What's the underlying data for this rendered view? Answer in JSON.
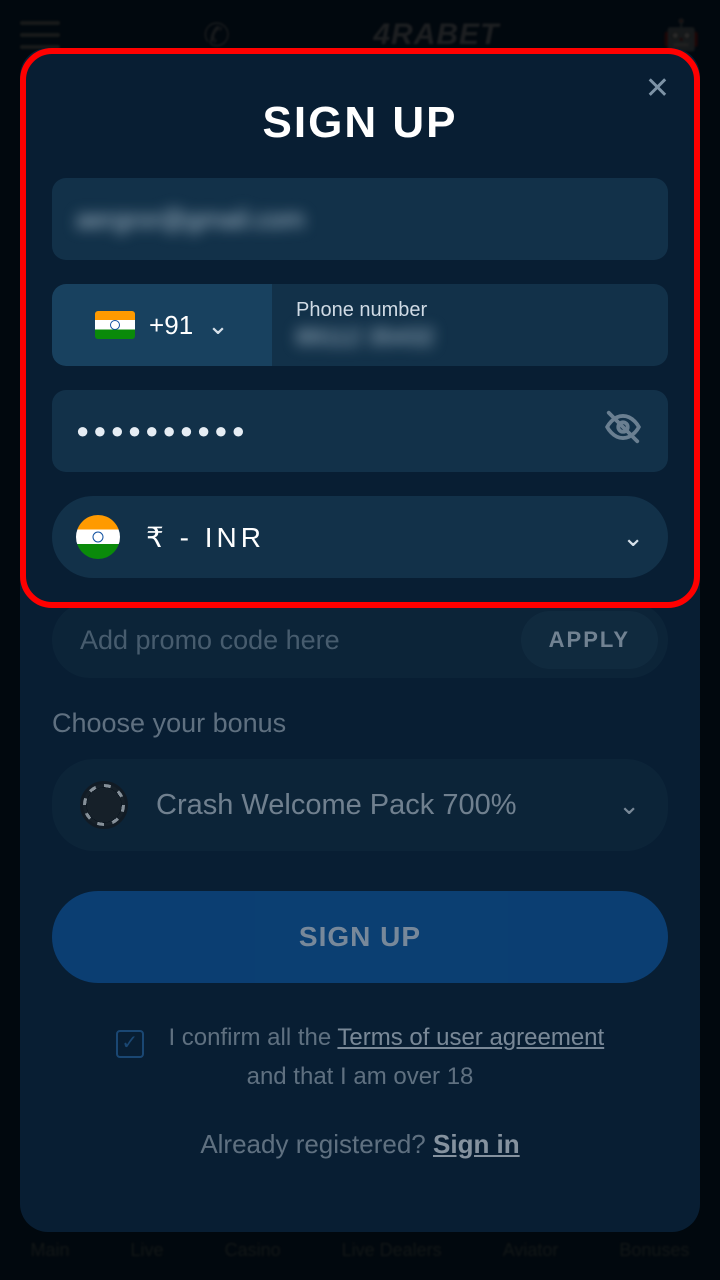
{
  "header": {
    "logo_text": "4RABET"
  },
  "nav": {
    "items": [
      "Main",
      "Live",
      "Casino",
      "Live Dealers",
      "Aviator",
      "Bonuses"
    ]
  },
  "modal": {
    "title": "SIGN UP",
    "email_blurred": "aergror@gmail.com",
    "country_code": "+91",
    "phone_label": "Phone number",
    "phone_blurred": "89112 35432",
    "password_dots": "●●●●●●●●●●",
    "currency_text": "₹  -  INR",
    "promo_placeholder": "Add promo code here",
    "apply_label": "APPLY",
    "choose_bonus_label": "Choose your bonus",
    "bonus_text": "Crash Welcome Pack 700%",
    "signup_button": "SIGN UP",
    "confirm_prefix": "I confirm all the ",
    "terms_link": "Terms of user agreement",
    "confirm_suffix": " and that I am over 18",
    "already_text": "Already registered? ",
    "signin_link": "Sign in"
  }
}
